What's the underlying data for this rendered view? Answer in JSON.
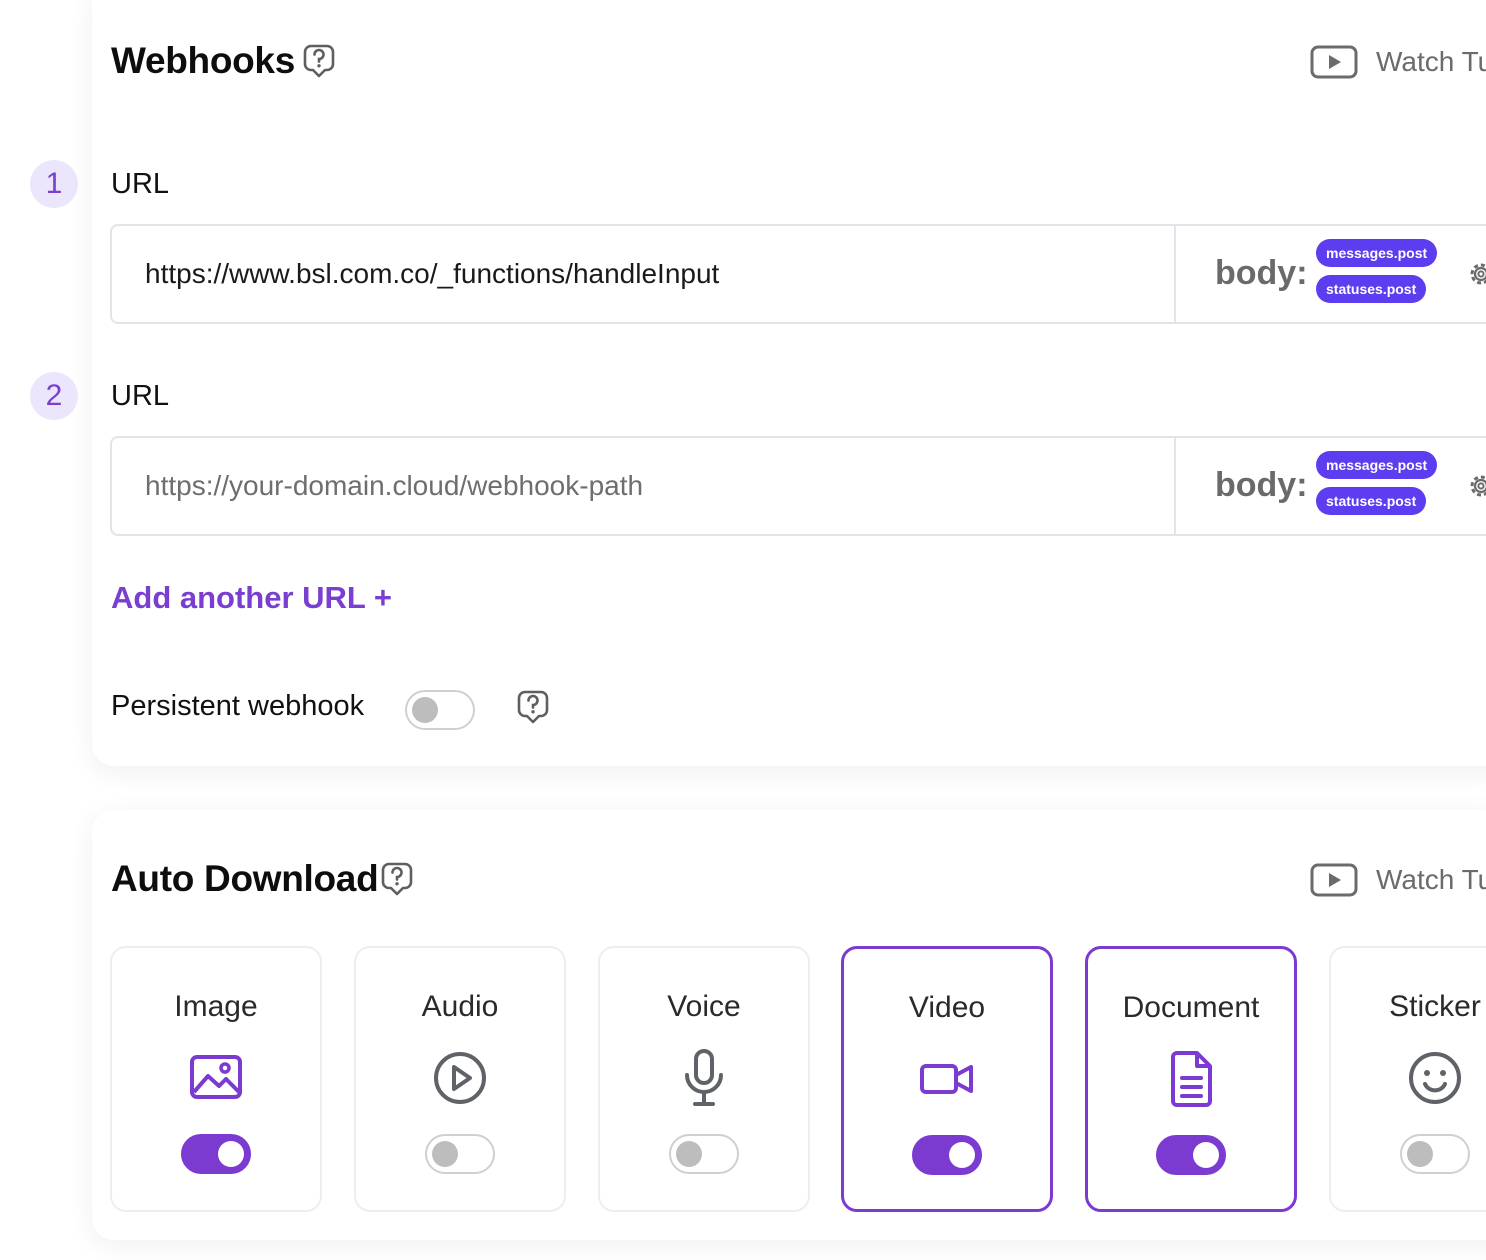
{
  "webhooks": {
    "title": "Webhooks",
    "help_icon": "question-pin-icon",
    "watch_tutorial": {
      "icon": "video-play-icon",
      "label": "Watch Tut"
    },
    "urls": [
      {
        "step": "1",
        "label": "URL",
        "value": "https://www.bsl.com.co/_functions/handleInput",
        "placeholder": "",
        "body_label": "body:",
        "tags": [
          "messages.post",
          "statuses.post"
        ],
        "settings_icon": "gear-icon"
      },
      {
        "step": "2",
        "label": "URL",
        "value": "",
        "placeholder": "https://your-domain.cloud/webhook-path",
        "body_label": "body:",
        "tags": [
          "messages.post",
          "statuses.post"
        ],
        "settings_icon": "gear-icon"
      }
    ],
    "add_url_label": "Add another URL +",
    "persistent": {
      "label": "Persistent webhook",
      "enabled": false,
      "help_icon": "question-pin-icon"
    }
  },
  "auto_download": {
    "title": "Auto Download",
    "help_icon": "question-pin-icon",
    "watch_tutorial": {
      "icon": "video-play-icon",
      "label": "Watch Tut"
    },
    "items": [
      {
        "label": "Image",
        "icon": "image-icon",
        "enabled": true
      },
      {
        "label": "Audio",
        "icon": "play-circle-icon",
        "enabled": false
      },
      {
        "label": "Voice",
        "icon": "microphone-icon",
        "enabled": false
      },
      {
        "label": "Video",
        "icon": "video-camera-icon",
        "enabled": true
      },
      {
        "label": "Document",
        "icon": "document-icon",
        "enabled": true
      },
      {
        "label": "Sticker",
        "icon": "smiley-icon",
        "enabled": false
      }
    ]
  },
  "colors": {
    "accent": "#7b3ad0",
    "tag_background": "#5e3df0",
    "badge_background": "#ebe6fb",
    "muted_text": "#6b6b6b",
    "border": "#e3e3ea"
  }
}
